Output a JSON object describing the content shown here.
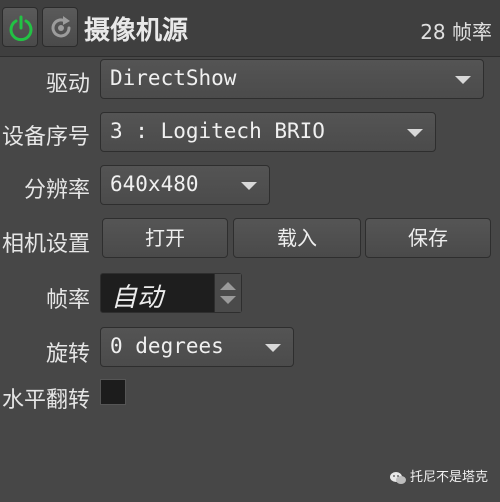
{
  "header": {
    "title": "摄像机源",
    "fps_display": "28 帧率",
    "power_icon": "power-icon",
    "refresh_icon": "refresh-icon"
  },
  "fields": {
    "driver": {
      "label": "驱动",
      "value": "DirectShow"
    },
    "device": {
      "label": "设备序号",
      "value": "3 : Logitech BRIO"
    },
    "resolution": {
      "label": "分辨率",
      "value": "640x480"
    },
    "camera_settings": {
      "label": "相机设置",
      "open_label": "打开",
      "load_label": "载入",
      "save_label": "保存"
    },
    "framerate": {
      "label": "帧率",
      "value": "自动"
    },
    "rotation": {
      "label": "旋转",
      "value": "0 degrees"
    },
    "flip": {
      "label": "水平翻转",
      "checked": false
    }
  },
  "watermark": {
    "text": "托尼不是塔克",
    "icon": "wechat-icon"
  },
  "colors": {
    "power_green": "#22c244",
    "background": "#474747",
    "header": "#3f3f3f"
  }
}
